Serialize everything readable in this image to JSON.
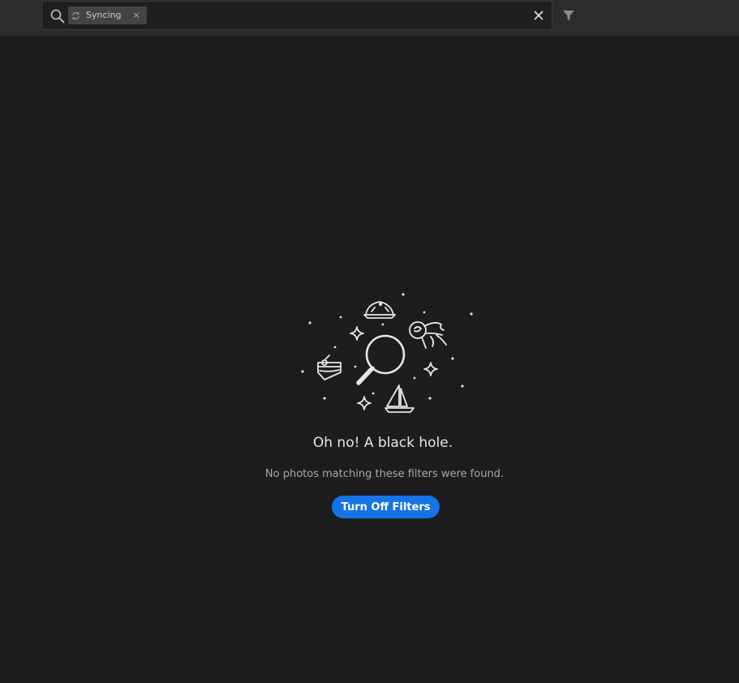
{
  "search": {
    "filter_chip": {
      "icon": "sync-icon",
      "label": "Syncing",
      "remove_glyph": "×"
    },
    "clear_glyph": "✕"
  },
  "empty_state": {
    "title": "Oh no! A black hole.",
    "message": "No photos matching these filters were found.",
    "button_label": "Turn Off Filters"
  },
  "colors": {
    "background": "#1d1d1d",
    "toolbar": "#2c2c2c",
    "accent": "#1473e6"
  }
}
